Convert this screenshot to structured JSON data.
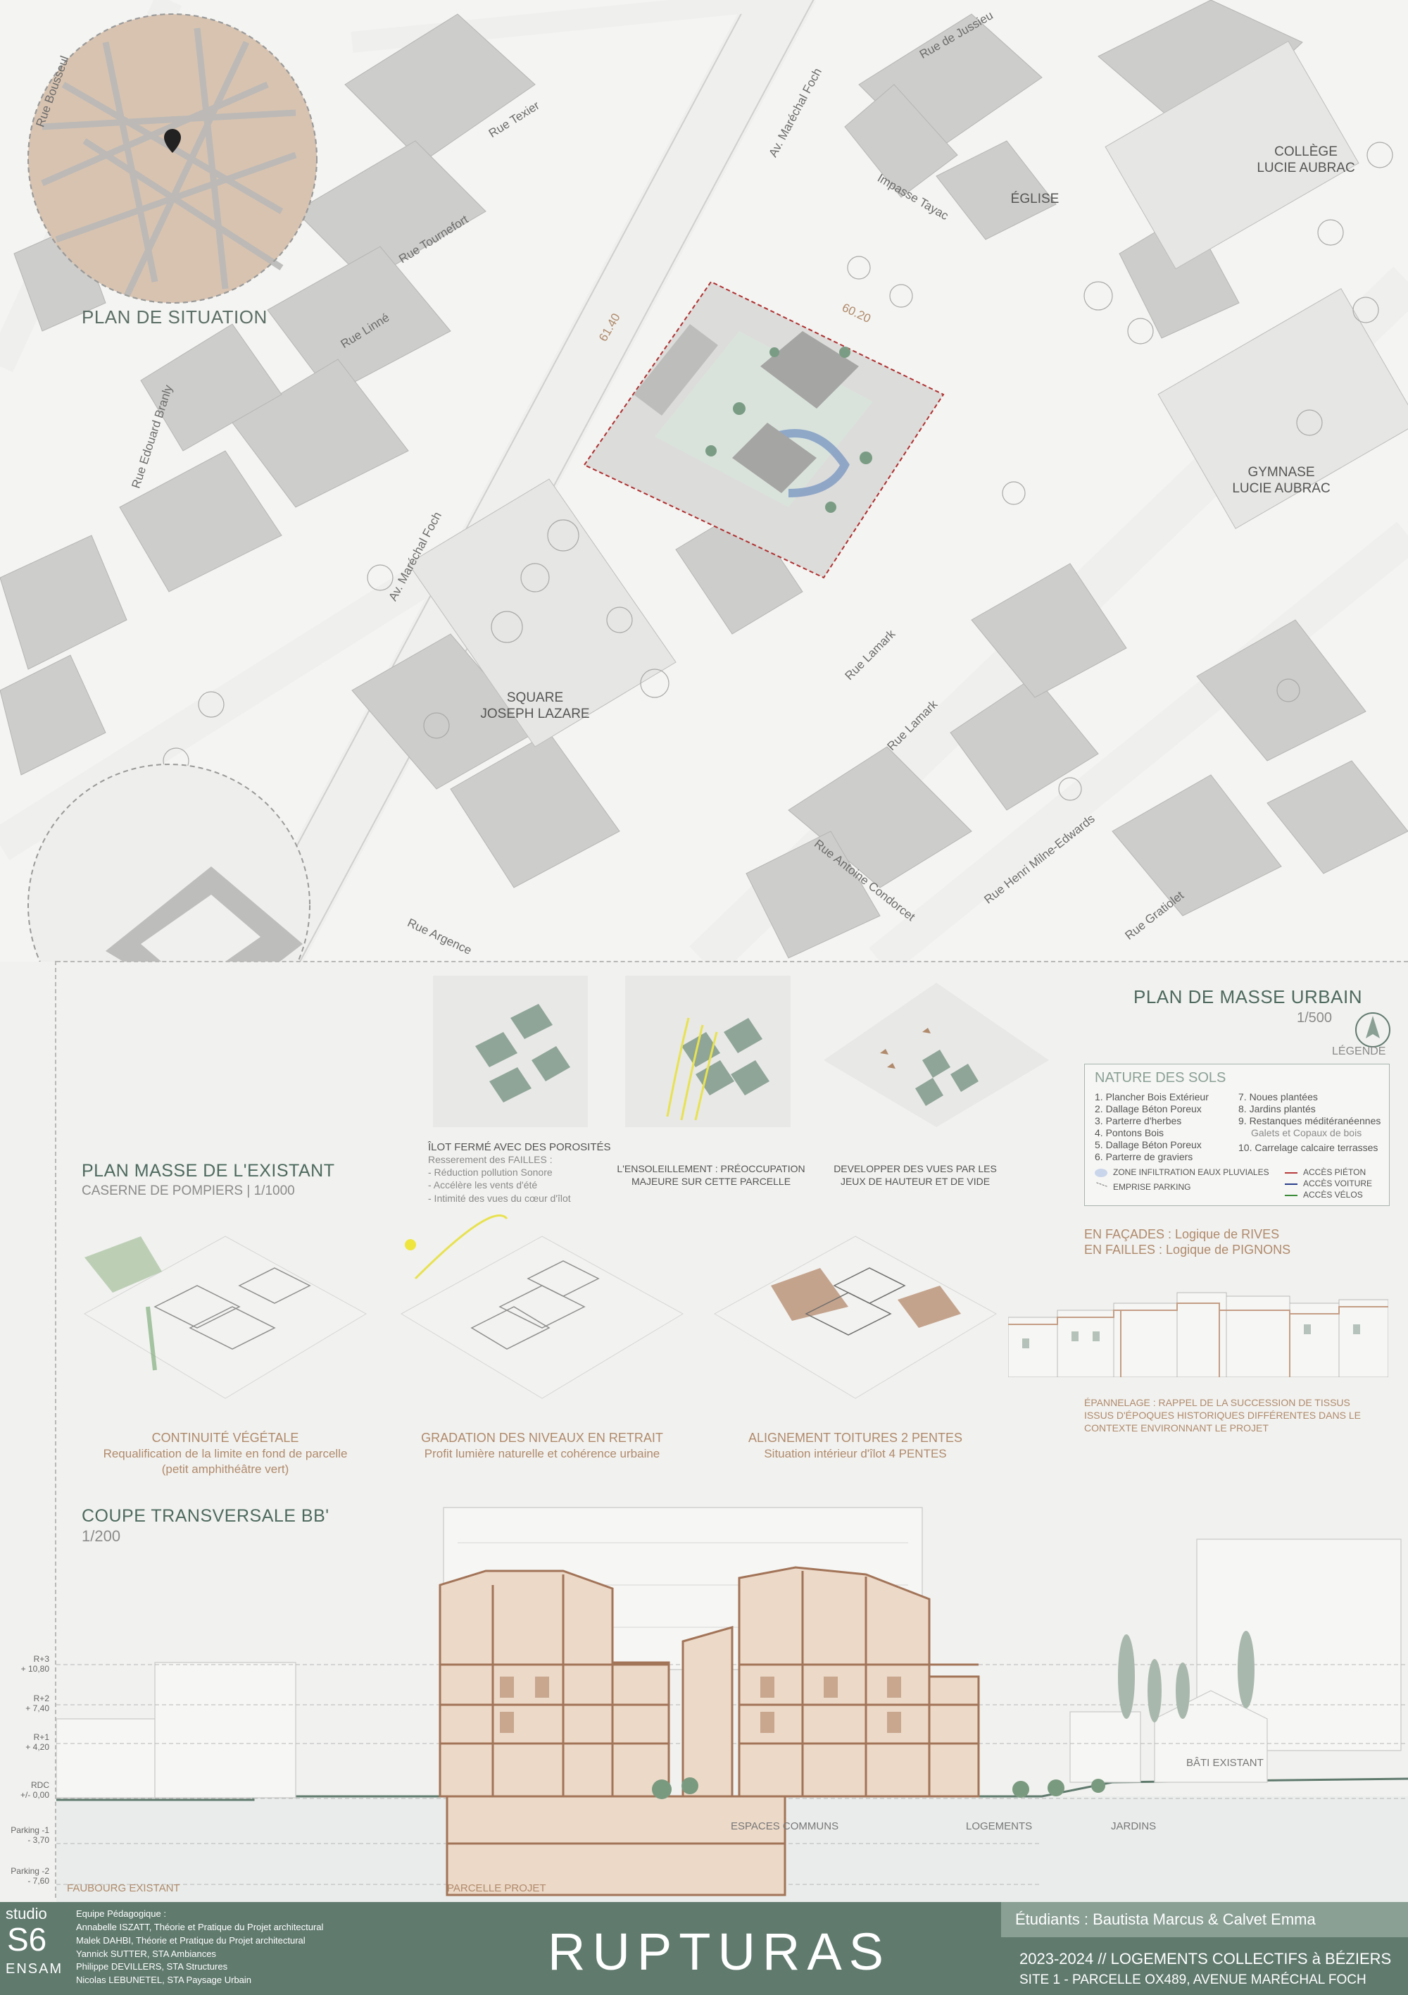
{
  "map": {
    "streets": [
      "Rue Bousseul",
      "Rue Texier",
      "Av. Maréchal Foch",
      "Rue de Jussieu",
      "Impasse Tayac",
      "Rue Tournefort",
      "Rue Linné",
      "Rue Edouard Branly",
      "Av. Maréchal Foch",
      "Rue Lamark",
      "Rue Lamark",
      "Rue Antoine Condorcet",
      "Rue Henri Milne-Edwards",
      "Rue Gratiolet",
      "Rue Argence"
    ],
    "places": {
      "college": "COLLÈGE\nLUCIE AUBRAC",
      "eglise": "ÉGLISE",
      "gymnase": "GYMNASE\nLUCIE AUBRAC",
      "square": "SQUARE\nJOSEPH LAZARE"
    },
    "dims": [
      "61.40",
      "60.20"
    ],
    "plan_situation": "PLAN DE SITUATION"
  },
  "existing": {
    "title": "PLAN MASSE DE L'EXISTANT",
    "subtitle": "CASERNE DE POMPIERS | 1/1000"
  },
  "urban": {
    "title": "PLAN DE MASSE URBAIN",
    "scale": "1/500",
    "legende": "LÉGENDE"
  },
  "legend": {
    "header": "NATURE DES SOLS",
    "left": [
      "1. Plancher Bois Extérieur",
      "2. Dallage Béton Poreux",
      "3. Parterre d'herbes",
      "4. Pontons Bois",
      "5. Dallage Béton Poreux",
      "6. Parterre de graviers"
    ],
    "right": [
      "7. Noues plantées",
      "8. Jardins plantés",
      "9. Restanques méditéranéennes"
    ],
    "right_note": "Galets et Copaux de bois",
    "right_last": "10. Carrelage calcaire terrasses",
    "zone": "ZONE INFILTRATION EAUX PLUVIALES",
    "parking": "EMPRISE PARKING",
    "acces": [
      "ACCÈS PIÉTON",
      "ACCÈS VOITURE",
      "ACCÈS VÉLOS"
    ],
    "acces_colors": [
      "#b83a3a",
      "#2b3f8c",
      "#3c8c3a"
    ]
  },
  "diagrams": {
    "d1": {
      "title": "ÎLOT FERMÉ AVEC DES POROSITÉS",
      "lines": [
        "Resserement des FAILLES :",
        "- Réduction pollution Sonore",
        "- Accélère les vents d'été",
        "- Intimité des vues du cœur d'îlot"
      ]
    },
    "d2": [
      "L'ENSOLEILLEMENT : PRÉOCCUPATION",
      "MAJEURE SUR CETTE PARCELLE"
    ],
    "d3": [
      "DEVELOPPER DES VUES PAR LES",
      "JEUX DE HAUTEUR ET DE VIDE"
    ]
  },
  "facade": {
    "line1": "EN FAÇADES : Logique de RIVES",
    "line2": "EN FAILLES : Logique de PIGNONS",
    "note": "ÉPANNELAGE : RAPPEL DE LA SUCCESSION DE TISSUS ISSUS D'ÉPOQUES HISTORIQUES DIFFÉRENTES DANS LE CONTEXTE ENVIRONNANT LE PROJET"
  },
  "axo": {
    "a1": {
      "title": "CONTINUITÉ VÉGÉTALE",
      "lines": [
        "Requalification de la limite en fond de parcelle",
        "(petit amphithéâtre vert)"
      ]
    },
    "a2": {
      "title": "GRADATION DES NIVEAUX EN RETRAIT",
      "lines": [
        "Profit lumière naturelle et cohérence urbaine"
      ]
    },
    "a3": {
      "title": "ALIGNEMENT TOITURES 2 PENTES",
      "lines": [
        "Situation intérieur d'îlot 4 PENTES"
      ]
    }
  },
  "section": {
    "title": "COUPE TRANSVERSALE BB'",
    "scale": "1/200",
    "levels": [
      [
        "R+3",
        "+ 10,80"
      ],
      [
        "R+2",
        "+ 7,40"
      ],
      [
        "R+1",
        "+ 4,20"
      ],
      [
        "RDC",
        "+/- 0,00"
      ],
      [
        "Parking -1",
        "- 3,70"
      ],
      [
        "Parking -2",
        "- 7,60"
      ]
    ],
    "labels": {
      "faubourg": "FAUBOURG EXISTANT",
      "parcelle": "PARCELLE PROJET",
      "communs": "ESPACES COMMUNS",
      "logements": "LOGEMENTS",
      "jardins": "JARDINS",
      "bati": "BÂTI EXISTANT"
    }
  },
  "footer": {
    "studio": "studio",
    "s6": "S6",
    "ensam": "ENSAM",
    "equipe": [
      "Equipe Pédagogique :",
      "Annabelle ISZATT, Théorie et Pratique du Projet architectural",
      "Malek DAHBI, Théorie et Pratique du Projet architectural",
      "Yannick SUTTER, STA Ambiances",
      "Philippe DEVILLERS, STA Structures",
      "Nicolas LEBUNETEL, STA Paysage Urbain"
    ],
    "brand": "RUPTURAS",
    "students": "Étudiants : Bautista Marcus & Calvet Emma",
    "year": "2023-2024 // LOGEMENTS COLLECTIFS à BÉZIERS",
    "site": "SITE 1 - PARCELLE OX489, AVENUE MARÉCHAL FOCH"
  }
}
